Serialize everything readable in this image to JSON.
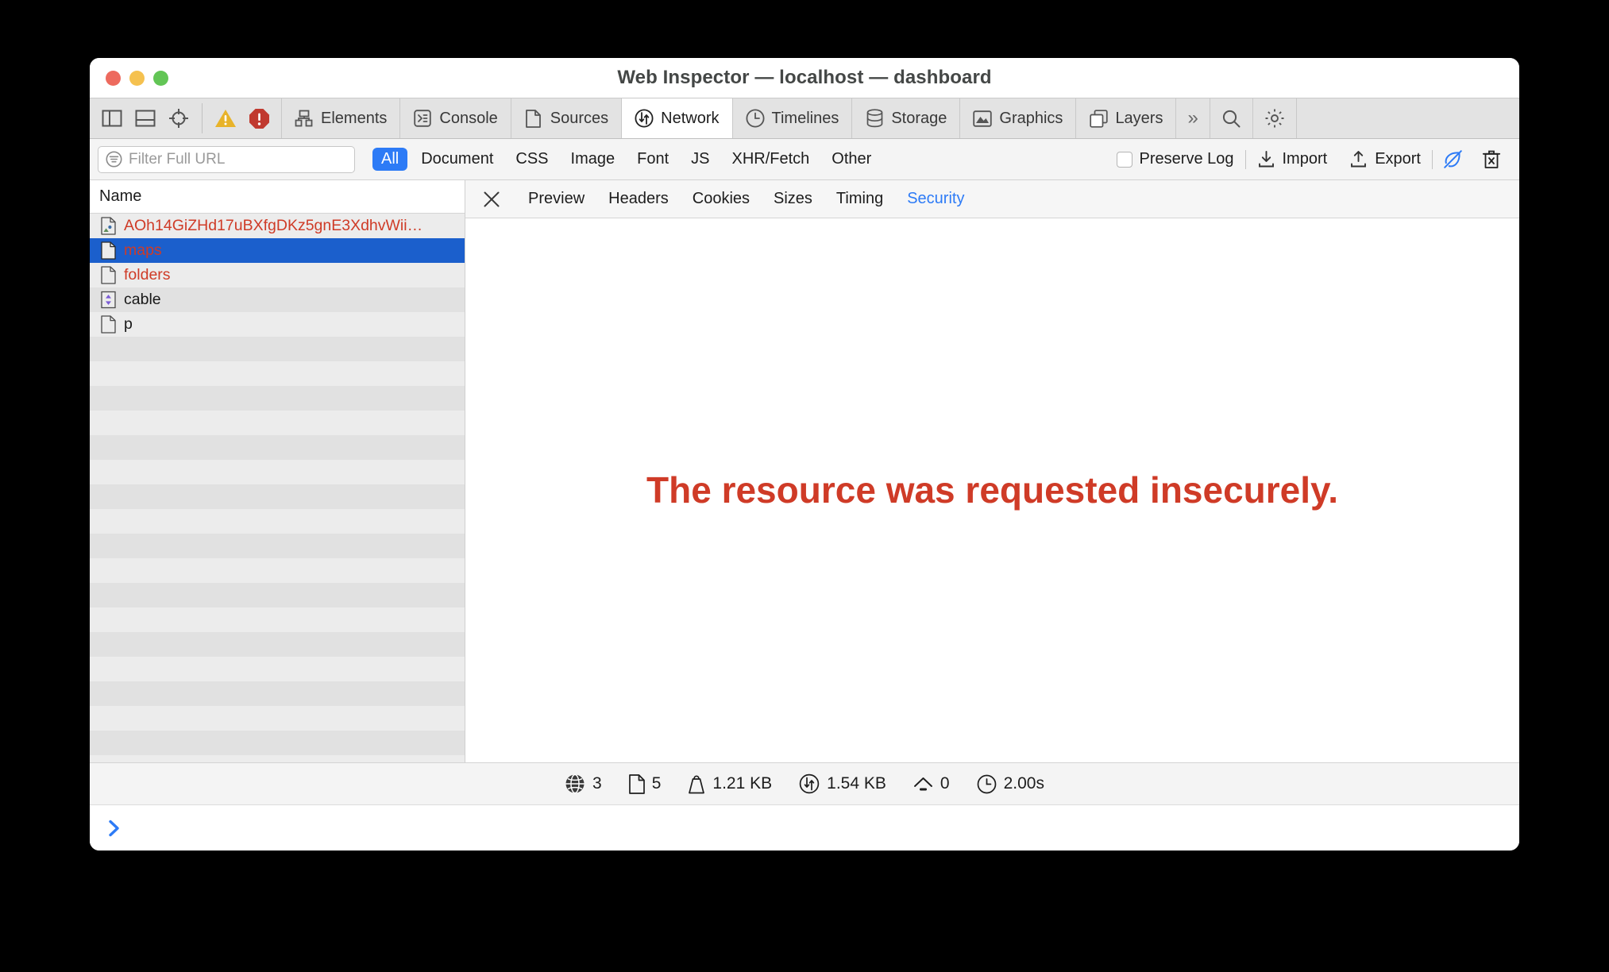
{
  "window": {
    "title": "Web Inspector — localhost — dashboard",
    "traffic_lights": [
      "close",
      "minimize",
      "zoom"
    ]
  },
  "toolbar": {
    "left_icons": [
      {
        "name": "toggle-sidebar-left-icon",
        "label": "Toggle Left Sidebar"
      },
      {
        "name": "toggle-sidebar-bottom-icon",
        "label": "Toggle Bottom Sidebar"
      },
      {
        "name": "element-selector-icon",
        "label": "Select Element"
      }
    ],
    "warning_count_icon": "warning-triangle-icon",
    "error_count_icon": "error-octagon-icon",
    "tabs": [
      {
        "label": "Elements",
        "icon": "elements-icon",
        "active": false
      },
      {
        "label": "Console",
        "icon": "console-icon",
        "active": false
      },
      {
        "label": "Sources",
        "icon": "sources-icon",
        "active": false
      },
      {
        "label": "Network",
        "icon": "network-icon",
        "active": true
      },
      {
        "label": "Timelines",
        "icon": "timelines-icon",
        "active": false
      },
      {
        "label": "Storage",
        "icon": "storage-icon",
        "active": false
      },
      {
        "label": "Graphics",
        "icon": "graphics-icon",
        "active": false
      },
      {
        "label": "Layers",
        "icon": "layers-icon",
        "active": false
      }
    ],
    "overflow_label": "»",
    "search_icon": "search-icon",
    "settings_icon": "gear-icon"
  },
  "filter_bar": {
    "search": {
      "placeholder": "Filter Full URL",
      "value": ""
    },
    "filter_icon": "filter-icon",
    "type_filters": [
      {
        "label": "All",
        "active": true
      },
      {
        "label": "Document",
        "active": false
      },
      {
        "label": "CSS",
        "active": false
      },
      {
        "label": "Image",
        "active": false
      },
      {
        "label": "Font",
        "active": false
      },
      {
        "label": "JS",
        "active": false
      },
      {
        "label": "XHR/Fetch",
        "active": false
      },
      {
        "label": "Other",
        "active": false
      }
    ],
    "preserve_log": {
      "label": "Preserve Log",
      "checked": false
    },
    "import": {
      "label": "Import",
      "icon": "import-download-icon"
    },
    "export": {
      "label": "Export",
      "icon": "export-upload-icon"
    },
    "disable_network_icon": "disable-resource-cache-icon",
    "clear_icon": "clear-network-items-icon"
  },
  "resource_list": {
    "column_header": "Name",
    "rows": [
      {
        "name": "AOh14GiZHd17uBXfgDKz5gnE3XdhvWii…",
        "icon": "image-document-icon",
        "error": true,
        "selected": false
      },
      {
        "name": "maps",
        "icon": "document-icon",
        "error": true,
        "selected": true
      },
      {
        "name": "folders",
        "icon": "document-icon",
        "error": true,
        "selected": false
      },
      {
        "name": "cable",
        "icon": "xhr-fetch-icon",
        "error": false,
        "selected": false
      },
      {
        "name": "p",
        "icon": "document-icon",
        "error": false,
        "selected": false
      }
    ],
    "empty_row_count": 17
  },
  "detail_panel": {
    "close_icon": "close-icon",
    "tabs": [
      {
        "label": "Preview",
        "active": false
      },
      {
        "label": "Headers",
        "active": false
      },
      {
        "label": "Cookies",
        "active": false
      },
      {
        "label": "Sizes",
        "active": false
      },
      {
        "label": "Timing",
        "active": false
      },
      {
        "label": "Security",
        "active": true
      }
    ],
    "message": "The resource was requested insecurely."
  },
  "status_bar": {
    "stats": [
      {
        "icon": "globe-icon",
        "value": "3"
      },
      {
        "icon": "document-icon",
        "value": "5"
      },
      {
        "icon": "weight-icon",
        "value": "1.21 KB"
      },
      {
        "icon": "transfer-size-icon",
        "value": "1.54 KB"
      },
      {
        "icon": "load-event-icon",
        "value": "0"
      },
      {
        "icon": "clock-icon",
        "value": "2.00s"
      }
    ]
  },
  "console_prompt": {
    "caret": "›",
    "value": ""
  },
  "colors": {
    "accent_blue": "#2d7bf6",
    "selection_blue": "#1b5fcc",
    "error_red": "#cf3b27",
    "warning_yellow": "#e8b32a",
    "error_octagon_red": "#c0392f",
    "xhr_purple": "#7b5cd6"
  }
}
